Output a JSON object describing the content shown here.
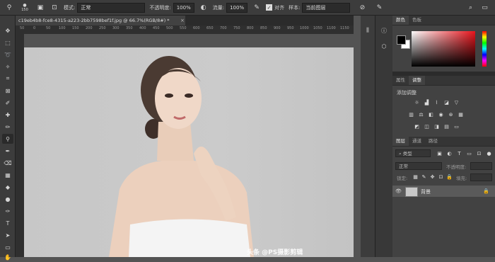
{
  "options_bar": {
    "brush_size": "150",
    "mode_label": "模式:",
    "mode_value": "正常",
    "opacity_label": "不透明度:",
    "opacity_value": "100%",
    "flow_label": "流量:",
    "flow_value": "100%",
    "align_label": "对齐",
    "sample_label": "样本:",
    "sample_value": "当前图层"
  },
  "document_tab": {
    "title": "c19eb4b8-fce8-4315-a223-2bb7598bef1f.jpg @ 66.7%(RGB/8#) *",
    "close": "×"
  },
  "ruler": {
    "marks": [
      "50",
      "0",
      "50",
      "100",
      "150",
      "200",
      "250",
      "300",
      "350",
      "400",
      "450",
      "500",
      "550",
      "600",
      "650",
      "700",
      "750",
      "800",
      "850",
      "900",
      "950",
      "1000",
      "1050",
      "1100",
      "1150"
    ]
  },
  "panels": {
    "color": {
      "tabs": [
        "颜色",
        "色板"
      ],
      "foreground": "#000000",
      "background": "#ffffff"
    },
    "adjustments": {
      "tabs": [
        "属性",
        "调整"
      ],
      "add_label": "添加调整"
    },
    "layers": {
      "tabs": [
        "图层",
        "通道",
        "路径"
      ],
      "filter_placeholder": "类型",
      "blend_mode": "正常",
      "opacity_label": "不透明度:",
      "lock_label": "锁定:",
      "fill_label": "填充:",
      "layer_name": "背景"
    }
  },
  "watermark": "头条 @PS摄影剪辑",
  "colors": {
    "accent_red": "#e8141c",
    "panel": "#424242",
    "canvas_bg": "#c5c5c5"
  }
}
